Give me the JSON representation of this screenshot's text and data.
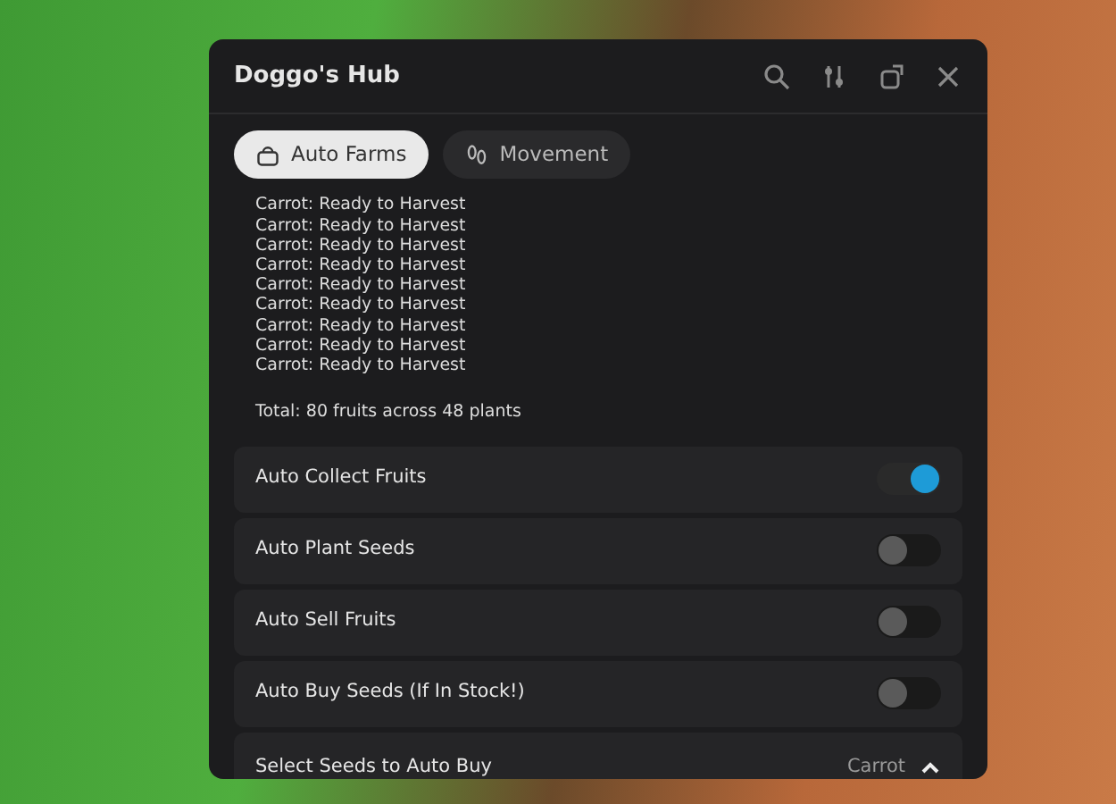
{
  "window": {
    "title": "Doggo's Hub"
  },
  "tabs": [
    {
      "label": "Auto Farms",
      "selected": true,
      "kind": "farm"
    },
    {
      "label": "Movement",
      "selected": false,
      "kind": "feet"
    }
  ],
  "log_lines": [
    "Carrot: Ready to Harvest",
    "Carrot: Ready to Harvest",
    "Carrot: Ready to Harvest",
    "Carrot: Ready to Harvest",
    "Carrot: Ready to Harvest",
    "Carrot: Ready to Harvest",
    "Carrot: Ready to Harvest",
    "Carrot: Ready to Harvest",
    "Carrot: Ready to Harvest"
  ],
  "total": "Total: 80 fruits across 48 plants",
  "options": [
    {
      "kind": "toggle",
      "label": "Auto Collect Fruits",
      "on": true
    },
    {
      "kind": "toggle",
      "label": "Auto Plant Seeds",
      "on": false
    },
    {
      "kind": "toggle",
      "label": "Auto Sell Fruits",
      "on": false
    },
    {
      "kind": "toggle",
      "label": "Auto Buy Seeds (If In Stock!)",
      "on": false
    },
    {
      "kind": "dropdown",
      "label": "Select Seeds to Auto Buy",
      "value": "Carrot",
      "expanded": true
    }
  ]
}
